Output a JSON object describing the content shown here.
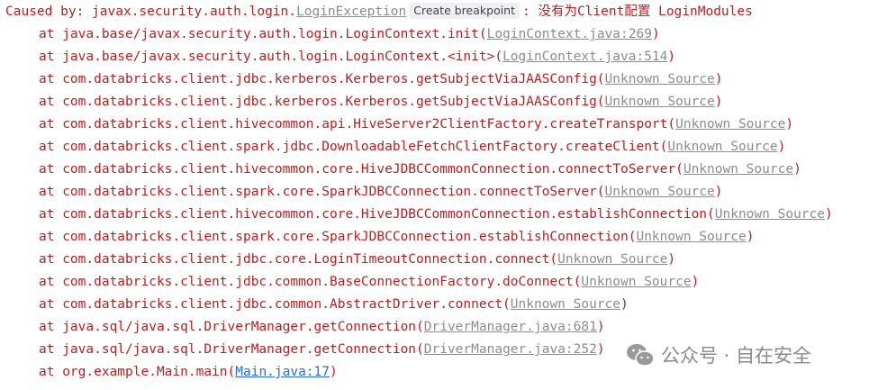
{
  "console": {
    "header": {
      "caused_by": "Caused by: javax.security.auth.login.",
      "exception_link": "LoginException",
      "breakpoint_button": "Create breakpoint",
      "message": ": 没有为Client配置 LoginModules"
    },
    "frames": [
      {
        "prefix": "at java.base/javax.security.auth.login.LoginContext.init(",
        "source": "LoginContext.java:269",
        "suffix": ")"
      },
      {
        "prefix": "at java.base/javax.security.auth.login.LoginContext.<init>(",
        "source": "LoginContext.java:514",
        "suffix": ")"
      },
      {
        "prefix": "at com.databricks.client.jdbc.kerberos.Kerberos.getSubjectViaJAASConfig(",
        "source": "Unknown Source",
        "suffix": ")"
      },
      {
        "prefix": "at com.databricks.client.jdbc.kerberos.Kerberos.getSubjectViaJAASConfig(",
        "source": "Unknown Source",
        "suffix": ")"
      },
      {
        "prefix": "at com.databricks.client.hivecommon.api.HiveServer2ClientFactory.createTransport(",
        "source": "Unknown Source",
        "suffix": ")"
      },
      {
        "prefix": "at com.databricks.client.spark.jdbc.DownloadableFetchClientFactory.createClient(",
        "source": "Unknown Source",
        "suffix": ")"
      },
      {
        "prefix": "at com.databricks.client.hivecommon.core.HiveJDBCCommonConnection.connectToServer(",
        "source": "Unknown Source",
        "suffix": ")"
      },
      {
        "prefix": "at com.databricks.client.spark.core.SparkJDBCConnection.connectToServer(",
        "source": "Unknown Source",
        "suffix": ")"
      },
      {
        "prefix": "at com.databricks.client.hivecommon.core.HiveJDBCCommonConnection.establishConnection(",
        "source": "Unknown Source",
        "suffix": ")"
      },
      {
        "prefix": "at com.databricks.client.spark.core.SparkJDBCConnection.establishConnection(",
        "source": "Unknown Source",
        "suffix": ")"
      },
      {
        "prefix": "at com.databricks.client.jdbc.core.LoginTimeoutConnection.connect(",
        "source": "Unknown Source",
        "suffix": ")"
      },
      {
        "prefix": "at com.databricks.client.jdbc.common.BaseConnectionFactory.doConnect(",
        "source": "Unknown Source",
        "suffix": ")"
      },
      {
        "prefix": "at com.databricks.client.jdbc.common.AbstractDriver.connect(",
        "source": "Unknown Source",
        "suffix": ")"
      },
      {
        "prefix": "at java.sql/java.sql.DriverManager.getConnection(",
        "source": "DriverManager.java:681",
        "suffix": ")"
      },
      {
        "prefix": "at java.sql/java.sql.DriverManager.getConnection(",
        "source": "DriverManager.java:252",
        "suffix": ")"
      },
      {
        "prefix": "at org.example.Main.main(",
        "source": "Main.java:17",
        "suffix": ")",
        "link_style": "blue"
      }
    ]
  },
  "watermark": {
    "icon": "wechat-icon",
    "text": "公众号 · 自在安全"
  },
  "colors": {
    "error_text": "#b22222",
    "library_link": "#8c8c8c",
    "project_link": "#2a6ed9",
    "chip_background": "#eef0f3"
  }
}
